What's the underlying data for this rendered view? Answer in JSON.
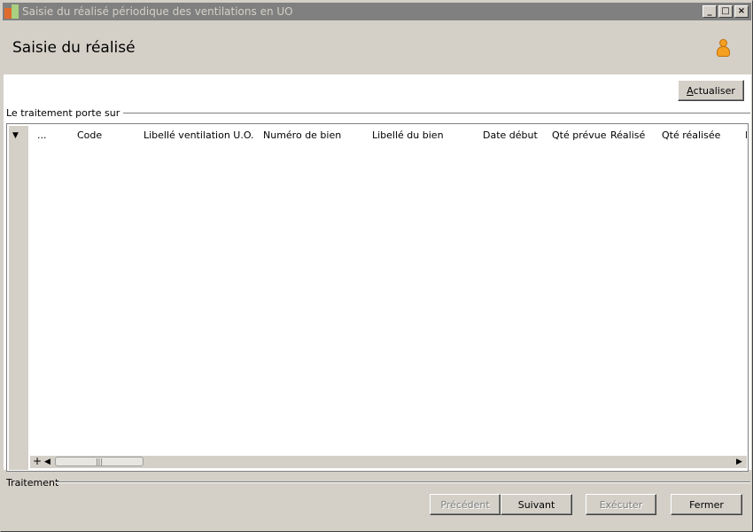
{
  "window": {
    "title": "Saisie du réalisé périodique des ventilations en UO",
    "minimize": "_",
    "maximize": "□",
    "close": "×"
  },
  "header": {
    "title": "Saisie du réalisé",
    "user_icon": "user-icon"
  },
  "toolbar": {
    "refresh_label_underlined": "A",
    "refresh_label_rest": "ctualiser"
  },
  "section": {
    "label": "Le traitement porte sur"
  },
  "grid": {
    "dropdown_glyph": "▼",
    "columns": [
      "...",
      "Code",
      "Libellé ventilation U.O.",
      "Numéro de bien",
      "Libellé du bien",
      "Date début",
      "Qté prévue",
      "Réalisé",
      "Qté réalisée",
      "D"
    ],
    "rows": [],
    "add_glyph": "+",
    "scroll_left_glyph": "◀",
    "scroll_thumb_glyph": "|||",
    "scroll_right_glyph": "▶"
  },
  "footer": {
    "label": "Traitement",
    "buttons": {
      "previous": "Précédent",
      "next": "Suivant",
      "execute": "Exécuter",
      "close": "Fermer"
    }
  }
}
